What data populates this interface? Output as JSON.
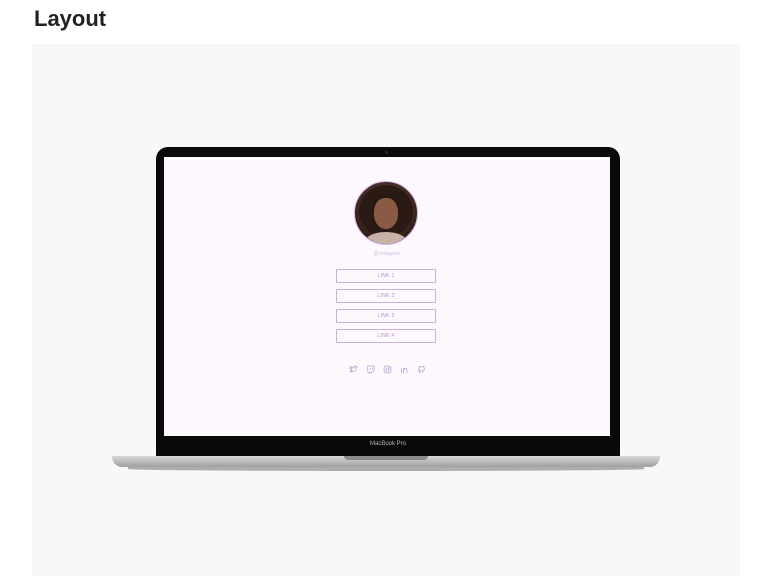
{
  "page": {
    "heading": "Layout"
  },
  "laptop": {
    "model_label": "MacBook Pro"
  },
  "profile": {
    "handle": "@instagram",
    "links": [
      {
        "label": "LINK 1"
      },
      {
        "label": "LINK 2"
      },
      {
        "label": "LINK 3"
      },
      {
        "label": "LINK 4"
      }
    ],
    "socials": [
      "twitter-icon",
      "twitch-icon",
      "instagram-icon",
      "linkedin-icon",
      "github-icon"
    ],
    "accent_color": "#b48fd1"
  }
}
